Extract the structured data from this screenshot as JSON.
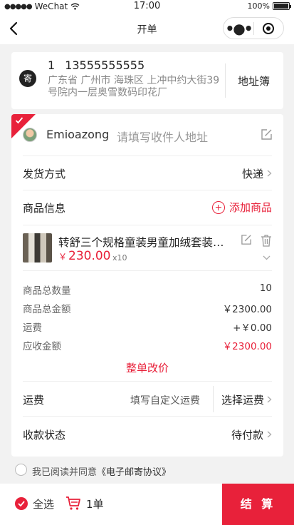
{
  "status_bar": {
    "carrier": "WeChat",
    "time": "17:00",
    "battery": "100%",
    "battery_level": 1.0
  },
  "nav": {
    "title": "开单"
  },
  "sender": {
    "badge": "寄",
    "name": "1",
    "phone": "13555555555",
    "address": "广东省 广州市 海珠区 上冲中约大街39号院内一层奥雪数码印花厂",
    "address_book": "地址簿"
  },
  "receiver": {
    "name": "Emioazong",
    "placeholder": "请填写收件人地址"
  },
  "shipping": {
    "label": "发货方式",
    "value": "快递"
  },
  "goods": {
    "label": "商品信息",
    "add_label": "添加商品"
  },
  "product": {
    "name": "转舒三个规格童装男童加绒套装新款",
    "currency": "￥",
    "price": "230.00",
    "qty": "x10"
  },
  "summary": [
    {
      "label": "商品总数量",
      "value": "10"
    },
    {
      "label": "商品总金额",
      "value": "￥2300.00"
    },
    {
      "label": "运费",
      "value": "+￥0.00"
    },
    {
      "label": "应收金额",
      "value": "￥2300.00"
    }
  ],
  "reprice_label": "整单改价",
  "freight": {
    "label": "运费",
    "custom": "填写自定义运费",
    "choose": "选择运费"
  },
  "payment": {
    "label": "收款状态",
    "value": "待付款"
  },
  "agreement": {
    "prefix": "我已阅读并同意",
    "link": "《电子邮寄协议》"
  },
  "bottom": {
    "select_all": "全选",
    "count": "1单",
    "settle": "结 算"
  },
  "colors": {
    "accent": "#e8213a"
  }
}
